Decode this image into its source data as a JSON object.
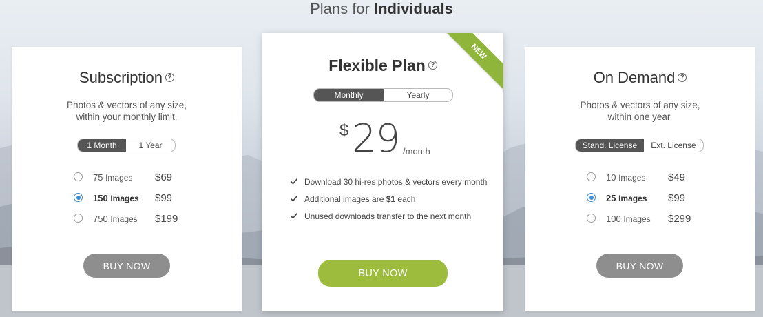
{
  "header": {
    "title_prefix": "Plans for ",
    "title_bold": "Individuals"
  },
  "subscription": {
    "title": "Subscription",
    "help": "?",
    "desc_line1": "Photos & vectors of any size,",
    "desc_line2": "within your monthly limit.",
    "toggle": [
      "1 Month",
      "1 Year"
    ],
    "toggle_selected": "1 Month",
    "options": [
      {
        "count": "75",
        "unit": "Images",
        "price": "$69",
        "selected": false
      },
      {
        "count": "150",
        "unit": "Images",
        "price": "$99",
        "selected": true
      },
      {
        "count": "750",
        "unit": "Images",
        "price": "$199",
        "selected": false
      }
    ],
    "buy_label": "BUY NOW"
  },
  "flexible": {
    "title": "Flexible Plan",
    "help": "?",
    "ribbon": "NEW",
    "toggle": [
      "Monthly",
      "Yearly"
    ],
    "toggle_selected": "Monthly",
    "currency": "$",
    "price": "29",
    "period": "/month",
    "features": [
      "Download 30 hi-res photos & vectors every month",
      "Additional images are $1 each",
      "Unused downloads transfer to the next month"
    ],
    "feature2_prefix": "Additional images are ",
    "feature2_bold": "$1",
    "feature2_suffix": " each",
    "buy_label": "BUY NOW"
  },
  "on_demand": {
    "title": "On Demand",
    "help": "?",
    "desc_line1": "Photos & vectors of any size,",
    "desc_line2": "within one year.",
    "toggle": [
      "Stand. License",
      "Ext. License"
    ],
    "toggle_selected": "Stand. License",
    "options": [
      {
        "count": "10",
        "unit": "Images",
        "price": "$49",
        "selected": false
      },
      {
        "count": "25",
        "unit": "Images",
        "price": "$99",
        "selected": true
      },
      {
        "count": "100",
        "unit": "Images",
        "price": "$299",
        "selected": false
      }
    ],
    "buy_label": "BUY NOW"
  },
  "colors": {
    "accent_green": "#9dbc3d",
    "radio_blue": "#3d8ed8",
    "button_grey": "#8e8e8e"
  }
}
